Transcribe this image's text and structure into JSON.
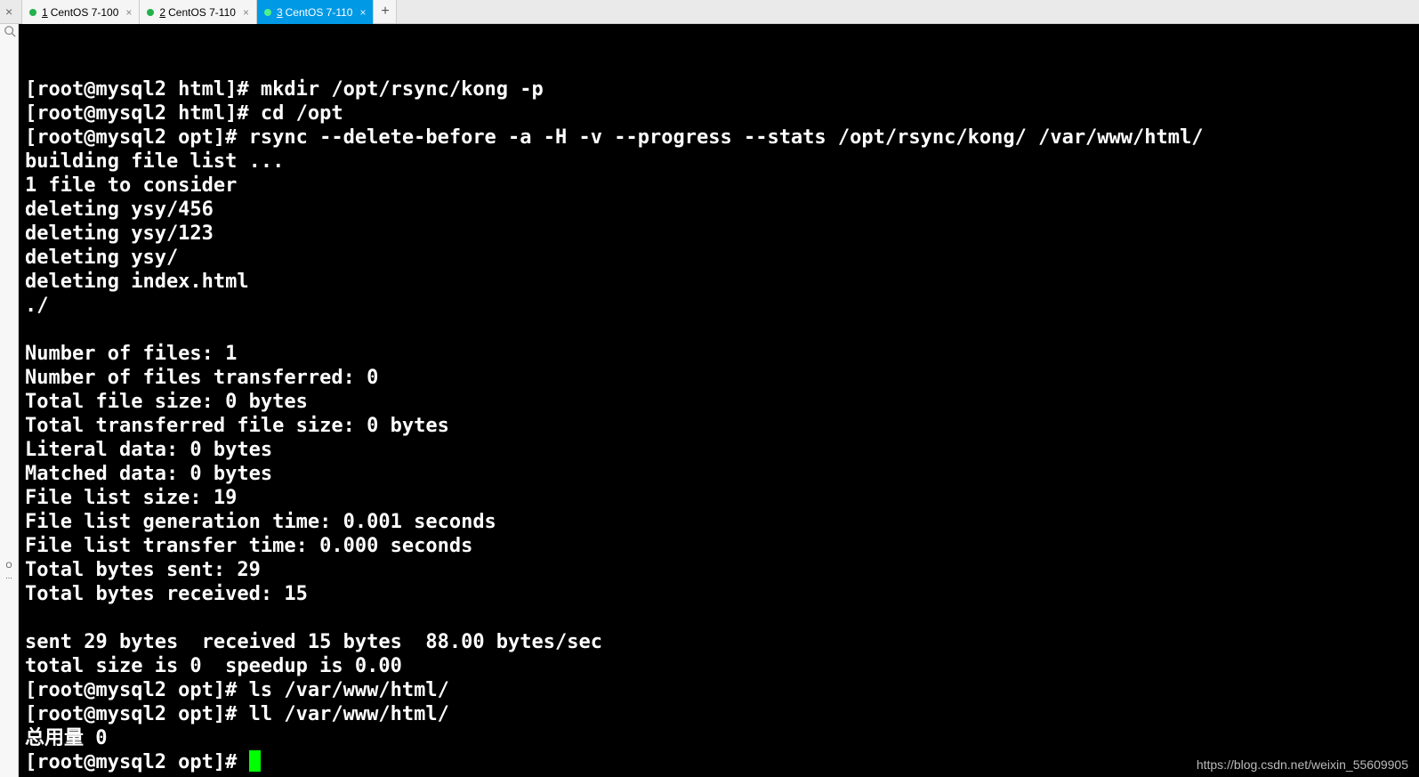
{
  "tabs": [
    {
      "index": "1",
      "label": "CentOS 7-100",
      "active": false
    },
    {
      "index": "2",
      "label": "CentOS 7-110",
      "active": false
    },
    {
      "index": "3",
      "label": "CentOS 7-110",
      "active": true
    }
  ],
  "sidebar": {
    "label1": "O",
    "label2": "..."
  },
  "terminal": {
    "lines": [
      "[root@mysql2 html]# mkdir /opt/rsync/kong -p",
      "[root@mysql2 html]# cd /opt",
      "[root@mysql2 opt]# rsync --delete-before -a -H -v --progress --stats /opt/rsync/kong/ /var/www/html/",
      "building file list ...",
      "1 file to consider",
      "deleting ysy/456",
      "deleting ysy/123",
      "deleting ysy/",
      "deleting index.html",
      "./",
      "",
      "Number of files: 1",
      "Number of files transferred: 0",
      "Total file size: 0 bytes",
      "Total transferred file size: 0 bytes",
      "Literal data: 0 bytes",
      "Matched data: 0 bytes",
      "File list size: 19",
      "File list generation time: 0.001 seconds",
      "File list transfer time: 0.000 seconds",
      "Total bytes sent: 29",
      "Total bytes received: 15",
      "",
      "sent 29 bytes  received 15 bytes  88.00 bytes/sec",
      "total size is 0  speedup is 0.00",
      "[root@mysql2 opt]# ls /var/www/html/",
      "[root@mysql2 opt]# ll /var/www/html/",
      "总用量 0"
    ],
    "prompt_line": "[root@mysql2 opt]# "
  },
  "watermark": "https://blog.csdn.net/weixin_55609905"
}
